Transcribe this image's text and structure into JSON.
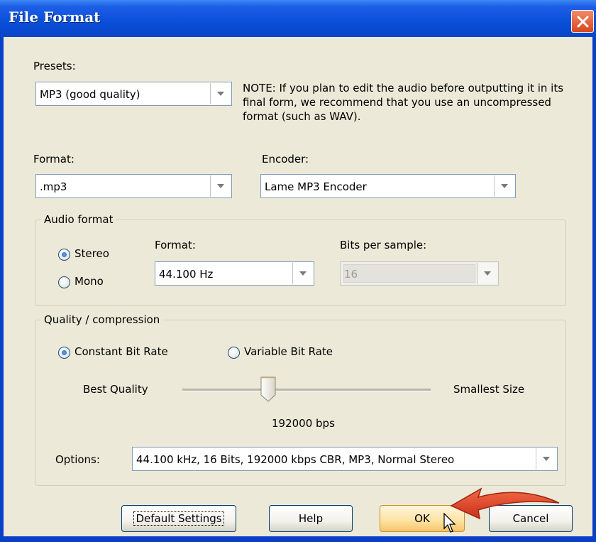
{
  "window": {
    "title": "File Format"
  },
  "presets": {
    "label": "Presets:",
    "value": "MP3 (good quality)",
    "note": "NOTE: If you plan to edit the audio before outputting it in its final form, we recommend that you use an uncompressed format (such as WAV)."
  },
  "format": {
    "label": "Format:",
    "value": ".mp3"
  },
  "encoder": {
    "label": "Encoder:",
    "value": "Lame MP3 Encoder"
  },
  "audio_format": {
    "title": "Audio format",
    "stereo_label": "Stereo",
    "mono_label": "Mono",
    "selected_channel": "Stereo",
    "format_label": "Format:",
    "format_value": "44.100 Hz",
    "bits_label": "Bits per sample:",
    "bits_value": "16"
  },
  "quality": {
    "title": "Quality / compression",
    "cbr_label": "Constant Bit Rate",
    "vbr_label": "Variable Bit Rate",
    "selected_mode": "Constant Bit Rate",
    "best_label": "Best Quality",
    "smallest_label": "Smallest Size",
    "slider_position_fraction": 0.36,
    "bitrate_text": "192000 bps",
    "options_label": "Options:",
    "options_value": "44.100 kHz, 16 Bits, 192000 kbps CBR, MP3, Normal Stereo"
  },
  "buttons": {
    "default_settings": "Default Settings",
    "help": "Help",
    "ok": "OK",
    "cancel": "Cancel"
  },
  "colors": {
    "titlebar": "#0a4fd8",
    "dialog_bg": "#ece9d8",
    "close_button": "#d9471f",
    "annotation_arrow": "#e8432a"
  },
  "icons": [
    "close-icon",
    "dropdown-arrow-icon",
    "mouse-cursor-icon",
    "annotation-arrow-icon"
  ]
}
